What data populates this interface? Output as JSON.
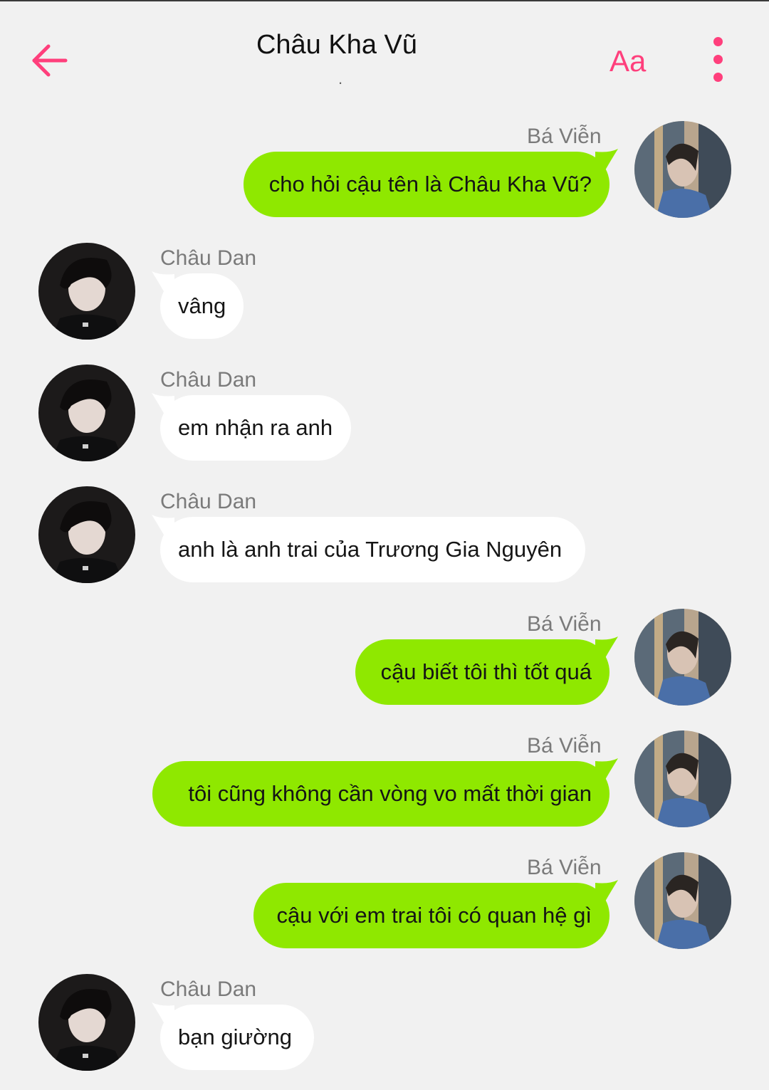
{
  "header": {
    "title": "Châu Kha Vũ",
    "subtitle": ".",
    "font_button": "Aa"
  },
  "colors": {
    "accent": "#ff3f7c",
    "outgoing_bubble": "#8fe800",
    "incoming_bubble": "#ffffff",
    "background": "#f1f1f1"
  },
  "messages": [
    {
      "sender": "Bá Viễn",
      "text": "cho hỏi cậu tên là Châu Kha Vũ?",
      "side": "right"
    },
    {
      "sender": "Châu Dan",
      "text": "vâng",
      "side": "left"
    },
    {
      "sender": "Châu Dan",
      "text": "em nhận ra anh",
      "side": "left"
    },
    {
      "sender": "Châu Dan",
      "text": "anh là anh trai của Trương Gia Nguyên",
      "side": "left"
    },
    {
      "sender": "Bá Viễn",
      "text": "cậu biết tôi thì tốt quá",
      "side": "right"
    },
    {
      "sender": "Bá Viễn",
      "text": "tôi cũng không cần vòng vo mất thời gian",
      "side": "right"
    },
    {
      "sender": "Bá Viễn",
      "text": "cậu với em trai tôi có quan hệ gì",
      "side": "right"
    },
    {
      "sender": "Châu Dan",
      "text": "bạn giường",
      "side": "left"
    }
  ]
}
